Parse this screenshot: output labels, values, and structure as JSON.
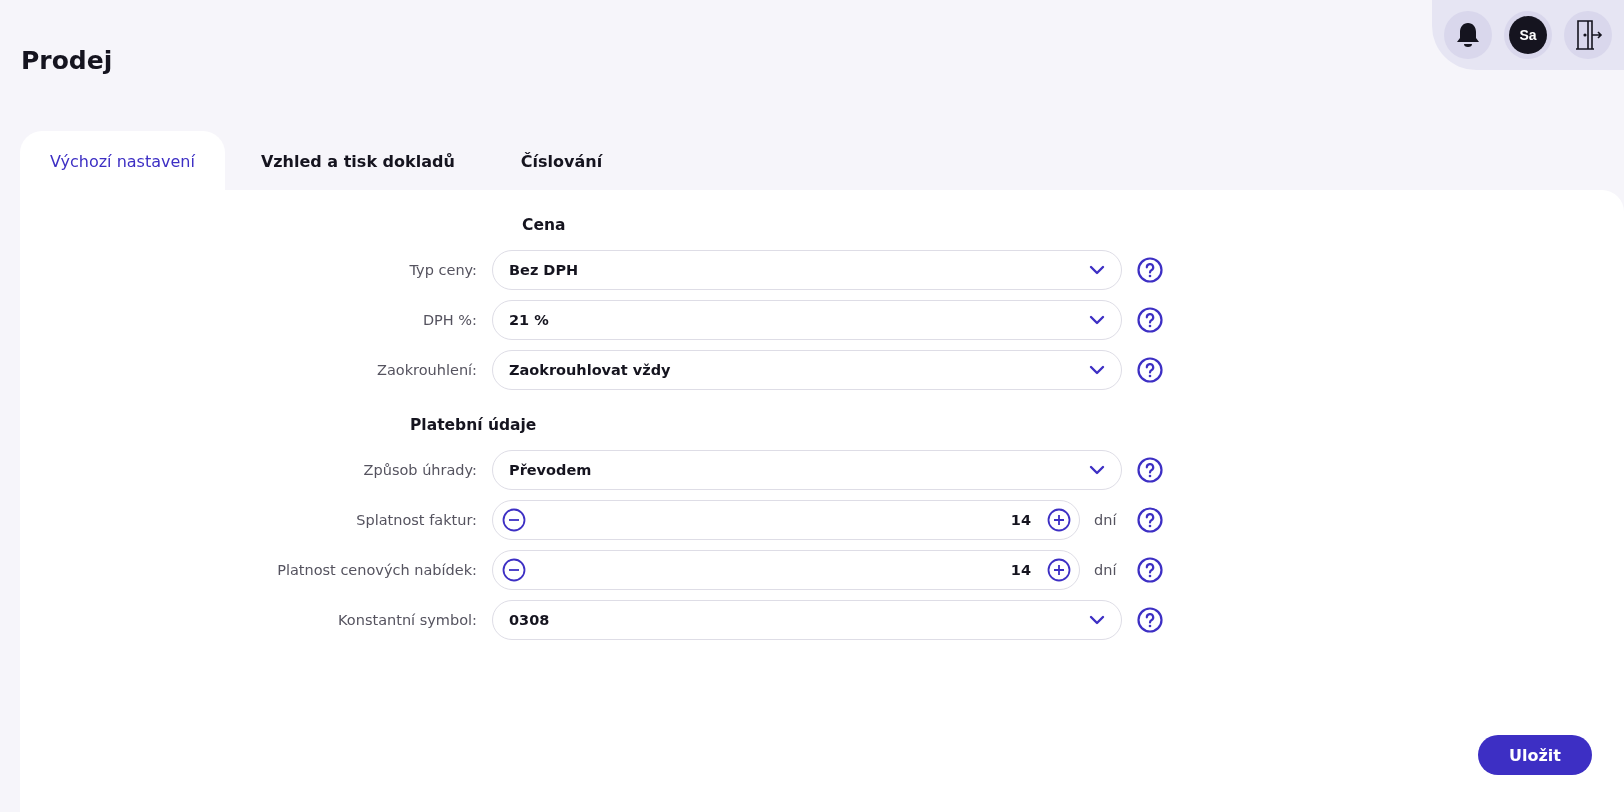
{
  "page_title": "Prodej",
  "tabs": [
    {
      "label": "Výchozí nastavení",
      "selected": true
    },
    {
      "label": "Vzhled a tisk dokladů",
      "selected": false
    },
    {
      "label": "Číslování",
      "selected": false
    }
  ],
  "user": {
    "initials": "Sa"
  },
  "sections": [
    {
      "heading": "Cena",
      "fields": [
        {
          "kind": "select",
          "label": "Typ ceny:",
          "value": "Bez DPH"
        },
        {
          "kind": "select",
          "label": "DPH %:",
          "value": "21 %"
        },
        {
          "kind": "select",
          "label": "Zaokrouhlení:",
          "value": "Zaokrouhlovat vždy"
        }
      ]
    },
    {
      "heading": "Platební údaje",
      "fields": [
        {
          "kind": "select",
          "label": "Způsob úhrady:",
          "value": "Převodem"
        },
        {
          "kind": "stepper",
          "label": "Splatnost faktur:",
          "value": "14",
          "unit": "dní"
        },
        {
          "kind": "stepper",
          "label": "Platnost cenových nabídek:",
          "value": "14",
          "unit": "dní"
        },
        {
          "kind": "select",
          "label": "Konstantní symbol:",
          "value": "0308"
        }
      ]
    }
  ],
  "save_button": "Uložit"
}
